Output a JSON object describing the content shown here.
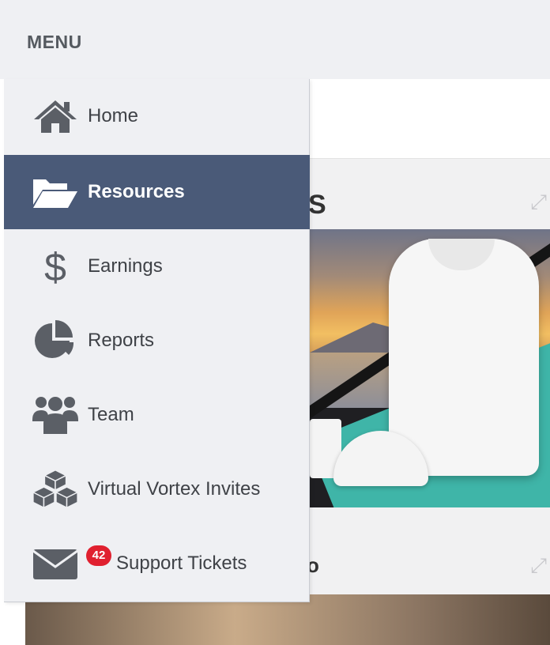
{
  "menu": {
    "title": "MENU"
  },
  "nav": {
    "items": [
      {
        "label": "Home",
        "icon": "home-icon"
      },
      {
        "label": "Resources",
        "icon": "folder-open-icon",
        "active": true
      },
      {
        "label": "Earnings",
        "icon": "dollar-icon"
      },
      {
        "label": "Reports",
        "icon": "pie-chart-icon"
      },
      {
        "label": "Team",
        "icon": "users-icon"
      },
      {
        "label": "Virtual Vortex Invites",
        "icon": "cubes-icon"
      },
      {
        "label": "Support Tickets",
        "icon": "envelope-icon",
        "badge": "42"
      }
    ]
  },
  "colors": {
    "drawer_bg": "#eff0f3",
    "active_bg": "#4a5a78",
    "text": "#3f4247",
    "icon": "#5b5f66",
    "badge": "#e0202f"
  }
}
